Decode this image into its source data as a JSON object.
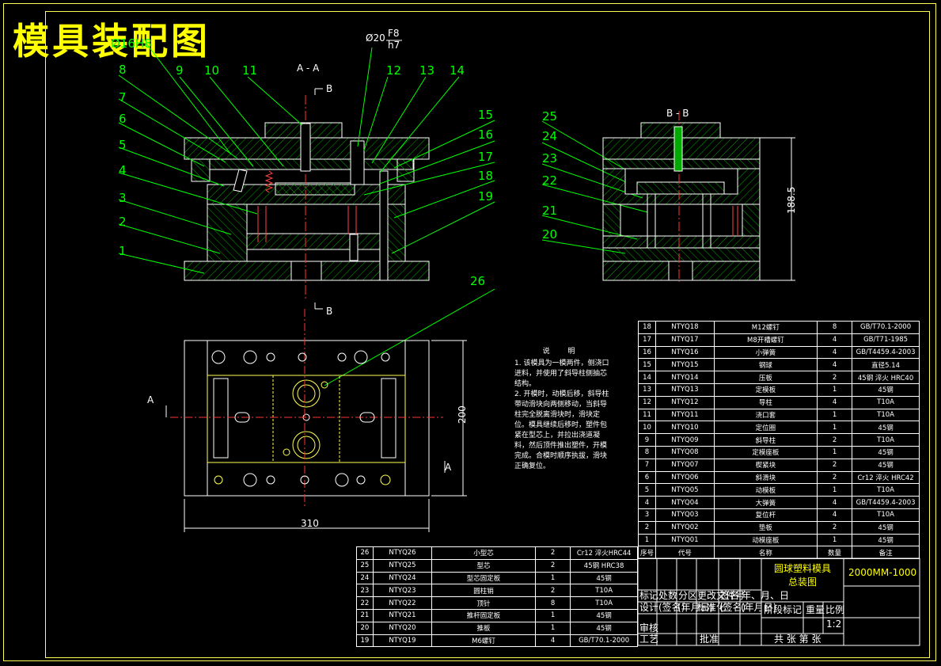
{
  "drawing_title": "模具装配图",
  "section_aa": "A - A",
  "section_bb": "B - B",
  "fit_label": "Ø20",
  "fit_top": "F8",
  "fit_bottom": "h7",
  "cut_b": "B",
  "cut_a": "A",
  "dim_width": "310",
  "dim_height": "200",
  "dim_side": "188.5",
  "notes": {
    "heading": "说 明",
    "lines": [
      "1. 该模具为一模两件，侧浇口进料，并使用了斜导柱侧抽芯结构。",
      "2. 开模时，动模后移，斜导柱带动滑块向两侧移动，当斜导柱完全脱离滑块时，滑块定位。模具继续后移时，塑件包紧在型芯上，并拉出浇道凝料，然后顶件推出塑件，开模完成。合模时顺序执拔，滑块正确复位。"
    ]
  },
  "bom_right": [
    [
      "18",
      "NTYQ18",
      "M12螺钉",
      "8",
      "GB/T70.1-2000"
    ],
    [
      "17",
      "NTYQ17",
      "M8开槽螺钉",
      "4",
      "GB/T71-1985"
    ],
    [
      "16",
      "NTYQ16",
      "小弹簧",
      "4",
      "GB/T4459.4-2003"
    ],
    [
      "15",
      "NTYQ15",
      "钢球",
      "4",
      "直径5.14"
    ],
    [
      "14",
      "NTYQ14",
      "压板",
      "2",
      "45钢 淬火 HRC40"
    ],
    [
      "13",
      "NTYQ13",
      "定模板",
      "1",
      "45钢"
    ],
    [
      "12",
      "NTYQ12",
      "导柱",
      "4",
      "T10A"
    ],
    [
      "11",
      "NTYQ11",
      "浇口套",
      "1",
      "T10A"
    ],
    [
      "10",
      "NTYQ10",
      "定位圈",
      "1",
      "45钢"
    ],
    [
      "9",
      "NTYQ09",
      "斜导柱",
      "2",
      "T10A"
    ],
    [
      "8",
      "NTYQ08",
      "定模座板",
      "1",
      "45钢"
    ],
    [
      "7",
      "NTYQ07",
      "楔紧块",
      "2",
      "45钢"
    ],
    [
      "6",
      "NTYQ06",
      "斜滑块",
      "2",
      "Cr12 淬火 HRC42"
    ],
    [
      "5",
      "NTYQ05",
      "动模板",
      "1",
      "T10A"
    ],
    [
      "4",
      "NTYQ04",
      "大弹簧",
      "4",
      "GB/T4459.4-2003"
    ],
    [
      "3",
      "NTYQ03",
      "复位杆",
      "4",
      "T10A"
    ],
    [
      "2",
      "NTYQ02",
      "垫板",
      "2",
      "45钢"
    ],
    [
      "1",
      "NTYQ01",
      "动模座板",
      "1",
      "45钢"
    ],
    [
      "序号",
      "代号",
      "名称",
      "数量",
      "备注"
    ]
  ],
  "bom_left": [
    [
      "26",
      "NTYQ26",
      "小型芯",
      "2",
      "Cr12 淬火HRC44"
    ],
    [
      "25",
      "NTYQ25",
      "型芯",
      "2",
      "45钢 HRC38"
    ],
    [
      "24",
      "NTYQ24",
      "型芯固定板",
      "1",
      "45钢"
    ],
    [
      "23",
      "NTYQ23",
      "圆柱销",
      "2",
      "T10A"
    ],
    [
      "22",
      "NTYQ22",
      "顶针",
      "8",
      "T10A"
    ],
    [
      "21",
      "NTYQ21",
      "推杆固定板",
      "1",
      "45钢"
    ],
    [
      "20",
      "NTYQ20",
      "推板",
      "1",
      "45钢"
    ],
    [
      "19",
      "NTYQ19",
      "M6螺钉",
      "4",
      "GB/T70.1-2000"
    ]
  ],
  "title_block": {
    "name_line1": "圆球塑料模具",
    "name_line2": "总装图",
    "code": "2000MM-1000",
    "scale": "1:2",
    "row_labels": [
      "标记",
      "处数",
      "分区",
      "更改文件号",
      "签名",
      "年、月、日"
    ],
    "design_labels": [
      "设计",
      "(签名)",
      "(年月日)",
      "标准化",
      "(签名)",
      "(年月日)"
    ],
    "stage_labels": [
      "阶段标记",
      "重量",
      "比例"
    ],
    "review": "审核",
    "process": "工艺",
    "approve": "批准",
    "sheets": "共 张 第 张"
  },
  "balloons_left": [
    "8",
    "7",
    "6",
    "5",
    "4",
    "3",
    "2",
    "1"
  ],
  "balloons_top": [
    "9",
    "10",
    "11",
    "12",
    "13",
    "14"
  ],
  "balloons_right": [
    "15",
    "16",
    "17",
    "18",
    "19"
  ],
  "balloons_side": [
    "25",
    "24",
    "23",
    "22",
    "21",
    "20"
  ],
  "balloon_26": "26",
  "balloon_ghost": "Ø16H8"
}
